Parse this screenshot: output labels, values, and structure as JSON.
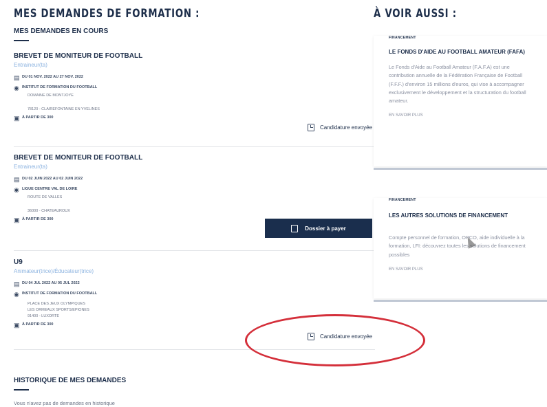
{
  "left": {
    "title": "MES DEMANDES DE FORMATION :",
    "current_label": "MES DEMANDES EN COURS",
    "demandes": [
      {
        "title": "BREVET DE MONITEUR DE FOOTBALL",
        "subtitle": "Entraineur(ta)",
        "dates": "DU 01 NOV. 2022 AU 27 NOV. 2022",
        "organisme": "INSTITUT DE FORMATION DU FOOTBALL",
        "lieu_lines": [
          "DOMAINE DE MONTJOYE",
          "78120 - CLAIREFONTAINE EN YVELINES"
        ],
        "prix": "À PARTIR DE 300",
        "status": "Candidature envoyée"
      },
      {
        "title": "BREVET DE MONITEUR DE FOOTBALL",
        "subtitle": "Entraineur(ta)",
        "dates": "DU 02 JUIN 2022 AU 02 JUIN 2022",
        "organisme": "LIGUE CENTRE VAL DE LOIRE",
        "lieu_lines": [
          "ROUTE DE VALLES",
          "36000 - CHATEAUROUX"
        ],
        "prix": "À PARTIR DE 300",
        "status": "Dossier à payer"
      },
      {
        "title": "U9",
        "subtitle": "Animateur(trice)/Éducateur(trice)",
        "dates": "DU 04 JUL 2022 AU 05 JUL 2022",
        "organisme": "INSTITUT DE FORMATION DU FOOTBALL",
        "lieu_lines": [
          "PLACE DES JEUX OLYMPIQUES",
          "LES ORMEAUX SPORTS/EPIONES",
          "91400 - LUXORTE"
        ],
        "prix": "À PARTIR DE 300",
        "status": "Candidature envoyée"
      }
    ],
    "history_label": "HISTORIQUE DE MES DEMANDES",
    "history_text": "Vous n'avez pas de demandes en historique"
  },
  "right": {
    "title": "À VOIR AUSSI :",
    "cards": [
      {
        "tag": "FINANCEMENT",
        "title": "LE FONDS D'AIDE AU FOOTBALL AMATEUR (FAFA)",
        "text": "Le Fonds d'Aide au Football Amateur (F.A.F.A) est une contribution annuelle de la Fédération Française de Football (F.F.F.) d'environ 15 millions d'euros, qui vise à accompagner exclusivement le développement et la structuration du football amateur.",
        "more": "EN SAVOIR PLUS"
      },
      {
        "tag": "FINANCEMENT",
        "title": "LES AUTRES SOLUTIONS DE FINANCEMENT",
        "text": "Compte personnel de formation, OPCO, aide individuelle à la formation, LFI: découvrez toutes les solutions de financement possibles",
        "more": "EN SAVOIR PLUS"
      }
    ]
  },
  "icons": {
    "calendar": "calendar-icon",
    "location": "location-pin-icon",
    "price": "price-card-icon",
    "document": "document-icon"
  },
  "colors": {
    "navy": "#1d2e4a",
    "button": "#1a2e4d",
    "link_blue": "#8cb3e0",
    "highlight_red": "#d42f3a"
  }
}
